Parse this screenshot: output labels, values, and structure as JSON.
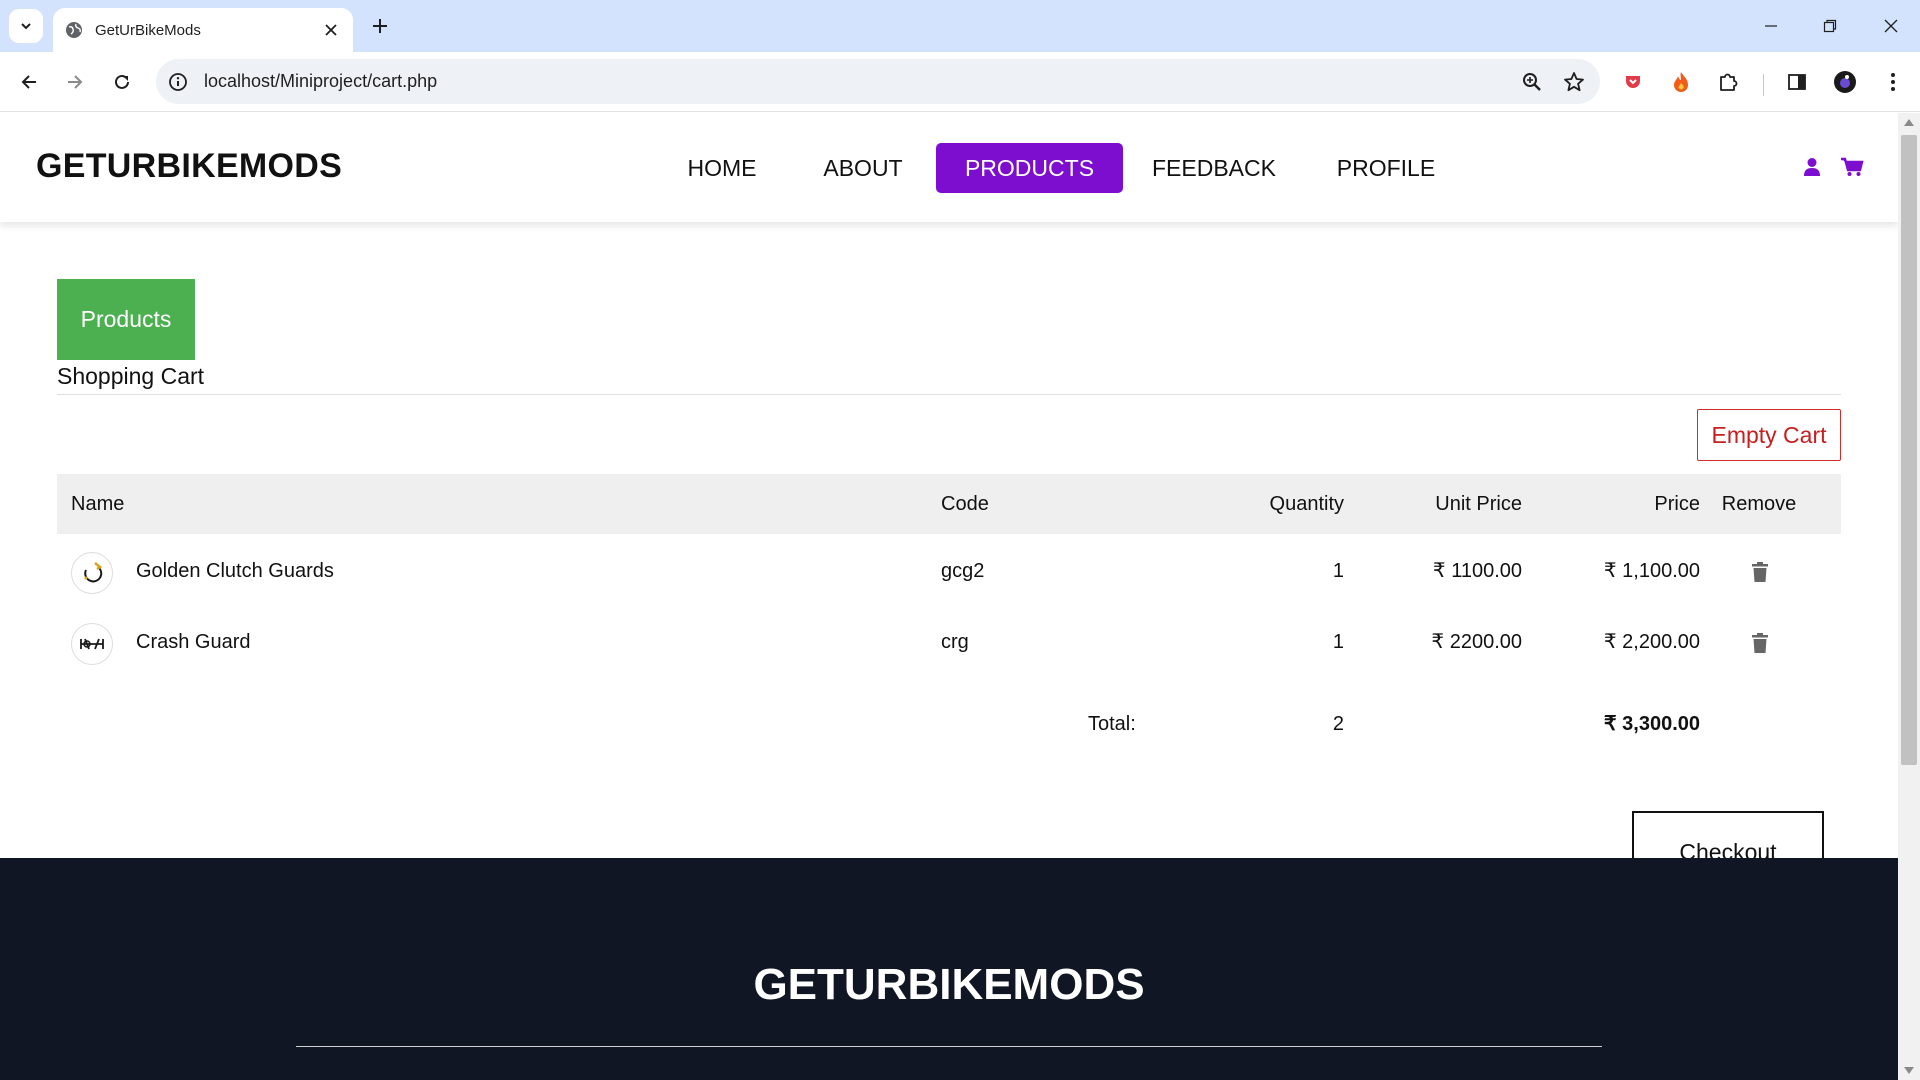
{
  "browser": {
    "tab_title": "GetUrBikeMods",
    "url": "localhost/Miniproject/cart.php"
  },
  "site": {
    "brand": "GETURBIKEMODS",
    "nav": [
      {
        "label": "HOME",
        "active": false
      },
      {
        "label": "ABOUT",
        "active": false
      },
      {
        "label": "PRODUCTS",
        "active": true
      },
      {
        "label": "FEEDBACK",
        "active": false
      },
      {
        "label": "PROFILE",
        "active": false
      }
    ],
    "accent_color": "#7e0ecf"
  },
  "content": {
    "products_button": "Products",
    "heading": "Shopping Cart",
    "empty_cart_button": "Empty Cart"
  },
  "table": {
    "headers": {
      "name": "Name",
      "code": "Code",
      "quantity": "Quantity",
      "unit_price": "Unit Price",
      "price": "Price",
      "remove": "Remove"
    },
    "rows": [
      {
        "name": "Golden Clutch Guards",
        "code": "gcg2",
        "quantity": "1",
        "unit_price": "₹ 1100.00",
        "price": "₹ 1,100.00"
      },
      {
        "name": "Crash Guard",
        "code": "crg",
        "quantity": "1",
        "unit_price": "₹ 2200.00",
        "price": "₹ 2,200.00"
      }
    ],
    "total_label": "Total:",
    "total_quantity": "2",
    "total_price": "₹ 3,300.00",
    "checkout_button": "Checkout"
  },
  "footer": {
    "brand": "GETURBIKEMODS"
  },
  "icons": {
    "tab_favicon": "globe-icon",
    "header_user": "user-icon",
    "header_cart": "cart-icon",
    "remove": "trash-icon"
  }
}
